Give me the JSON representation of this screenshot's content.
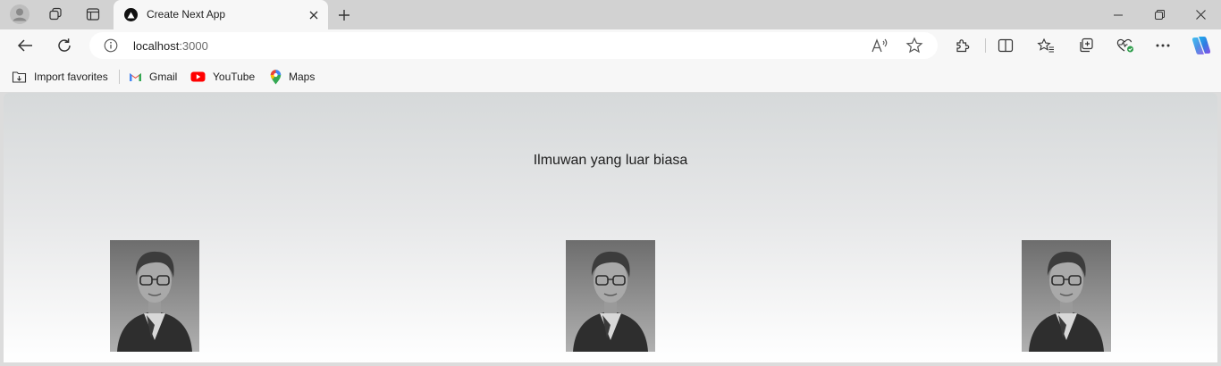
{
  "browser": {
    "tab": {
      "title": "Create Next App"
    },
    "address": {
      "host": "localhost",
      "port": ":3000"
    },
    "bookmarks": [
      {
        "label": "Import favorites",
        "icon": "import-favorites-icon"
      },
      {
        "label": "Gmail",
        "icon": "gmail-icon"
      },
      {
        "label": "YouTube",
        "icon": "youtube-icon"
      },
      {
        "label": "Maps",
        "icon": "maps-icon"
      }
    ]
  },
  "page": {
    "heading": "Ilmuwan yang luar biasa",
    "photos": [
      {
        "name": "scientist-photo-1"
      },
      {
        "name": "scientist-photo-2"
      },
      {
        "name": "scientist-photo-3"
      }
    ]
  },
  "colors": {
    "chrome": "#d2d2d2",
    "toolbar": "#f7f7f7",
    "copilot_accent": "#2f7de1",
    "youtube_red": "#ff0000"
  }
}
